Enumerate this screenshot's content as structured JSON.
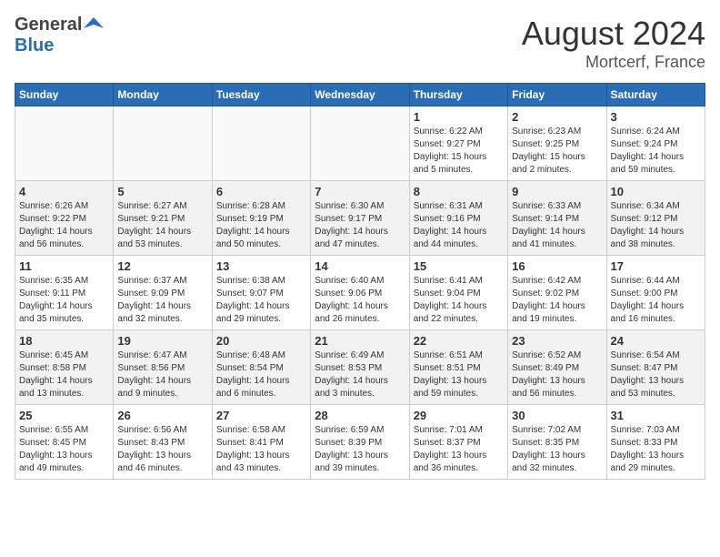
{
  "header": {
    "logo_general": "General",
    "logo_blue": "Blue",
    "month": "August 2024",
    "location": "Mortcerf, France"
  },
  "days_of_week": [
    "Sunday",
    "Monday",
    "Tuesday",
    "Wednesday",
    "Thursday",
    "Friday",
    "Saturday"
  ],
  "weeks": [
    [
      {
        "day": "",
        "info": ""
      },
      {
        "day": "",
        "info": ""
      },
      {
        "day": "",
        "info": ""
      },
      {
        "day": "",
        "info": ""
      },
      {
        "day": "1",
        "info": "Sunrise: 6:22 AM\nSunset: 9:27 PM\nDaylight: 15 hours\nand 5 minutes."
      },
      {
        "day": "2",
        "info": "Sunrise: 6:23 AM\nSunset: 9:25 PM\nDaylight: 15 hours\nand 2 minutes."
      },
      {
        "day": "3",
        "info": "Sunrise: 6:24 AM\nSunset: 9:24 PM\nDaylight: 14 hours\nand 59 minutes."
      }
    ],
    [
      {
        "day": "4",
        "info": "Sunrise: 6:26 AM\nSunset: 9:22 PM\nDaylight: 14 hours\nand 56 minutes."
      },
      {
        "day": "5",
        "info": "Sunrise: 6:27 AM\nSunset: 9:21 PM\nDaylight: 14 hours\nand 53 minutes."
      },
      {
        "day": "6",
        "info": "Sunrise: 6:28 AM\nSunset: 9:19 PM\nDaylight: 14 hours\nand 50 minutes."
      },
      {
        "day": "7",
        "info": "Sunrise: 6:30 AM\nSunset: 9:17 PM\nDaylight: 14 hours\nand 47 minutes."
      },
      {
        "day": "8",
        "info": "Sunrise: 6:31 AM\nSunset: 9:16 PM\nDaylight: 14 hours\nand 44 minutes."
      },
      {
        "day": "9",
        "info": "Sunrise: 6:33 AM\nSunset: 9:14 PM\nDaylight: 14 hours\nand 41 minutes."
      },
      {
        "day": "10",
        "info": "Sunrise: 6:34 AM\nSunset: 9:12 PM\nDaylight: 14 hours\nand 38 minutes."
      }
    ],
    [
      {
        "day": "11",
        "info": "Sunrise: 6:35 AM\nSunset: 9:11 PM\nDaylight: 14 hours\nand 35 minutes."
      },
      {
        "day": "12",
        "info": "Sunrise: 6:37 AM\nSunset: 9:09 PM\nDaylight: 14 hours\nand 32 minutes."
      },
      {
        "day": "13",
        "info": "Sunrise: 6:38 AM\nSunset: 9:07 PM\nDaylight: 14 hours\nand 29 minutes."
      },
      {
        "day": "14",
        "info": "Sunrise: 6:40 AM\nSunset: 9:06 PM\nDaylight: 14 hours\nand 26 minutes."
      },
      {
        "day": "15",
        "info": "Sunrise: 6:41 AM\nSunset: 9:04 PM\nDaylight: 14 hours\nand 22 minutes."
      },
      {
        "day": "16",
        "info": "Sunrise: 6:42 AM\nSunset: 9:02 PM\nDaylight: 14 hours\nand 19 minutes."
      },
      {
        "day": "17",
        "info": "Sunrise: 6:44 AM\nSunset: 9:00 PM\nDaylight: 14 hours\nand 16 minutes."
      }
    ],
    [
      {
        "day": "18",
        "info": "Sunrise: 6:45 AM\nSunset: 8:58 PM\nDaylight: 14 hours\nand 13 minutes."
      },
      {
        "day": "19",
        "info": "Sunrise: 6:47 AM\nSunset: 8:56 PM\nDaylight: 14 hours\nand 9 minutes."
      },
      {
        "day": "20",
        "info": "Sunrise: 6:48 AM\nSunset: 8:54 PM\nDaylight: 14 hours\nand 6 minutes."
      },
      {
        "day": "21",
        "info": "Sunrise: 6:49 AM\nSunset: 8:53 PM\nDaylight: 14 hours\nand 3 minutes."
      },
      {
        "day": "22",
        "info": "Sunrise: 6:51 AM\nSunset: 8:51 PM\nDaylight: 13 hours\nand 59 minutes."
      },
      {
        "day": "23",
        "info": "Sunrise: 6:52 AM\nSunset: 8:49 PM\nDaylight: 13 hours\nand 56 minutes."
      },
      {
        "day": "24",
        "info": "Sunrise: 6:54 AM\nSunset: 8:47 PM\nDaylight: 13 hours\nand 53 minutes."
      }
    ],
    [
      {
        "day": "25",
        "info": "Sunrise: 6:55 AM\nSunset: 8:45 PM\nDaylight: 13 hours\nand 49 minutes."
      },
      {
        "day": "26",
        "info": "Sunrise: 6:56 AM\nSunset: 8:43 PM\nDaylight: 13 hours\nand 46 minutes."
      },
      {
        "day": "27",
        "info": "Sunrise: 6:58 AM\nSunset: 8:41 PM\nDaylight: 13 hours\nand 43 minutes."
      },
      {
        "day": "28",
        "info": "Sunrise: 6:59 AM\nSunset: 8:39 PM\nDaylight: 13 hours\nand 39 minutes."
      },
      {
        "day": "29",
        "info": "Sunrise: 7:01 AM\nSunset: 8:37 PM\nDaylight: 13 hours\nand 36 minutes."
      },
      {
        "day": "30",
        "info": "Sunrise: 7:02 AM\nSunset: 8:35 PM\nDaylight: 13 hours\nand 32 minutes."
      },
      {
        "day": "31",
        "info": "Sunrise: 7:03 AM\nSunset: 8:33 PM\nDaylight: 13 hours\nand 29 minutes."
      }
    ]
  ]
}
